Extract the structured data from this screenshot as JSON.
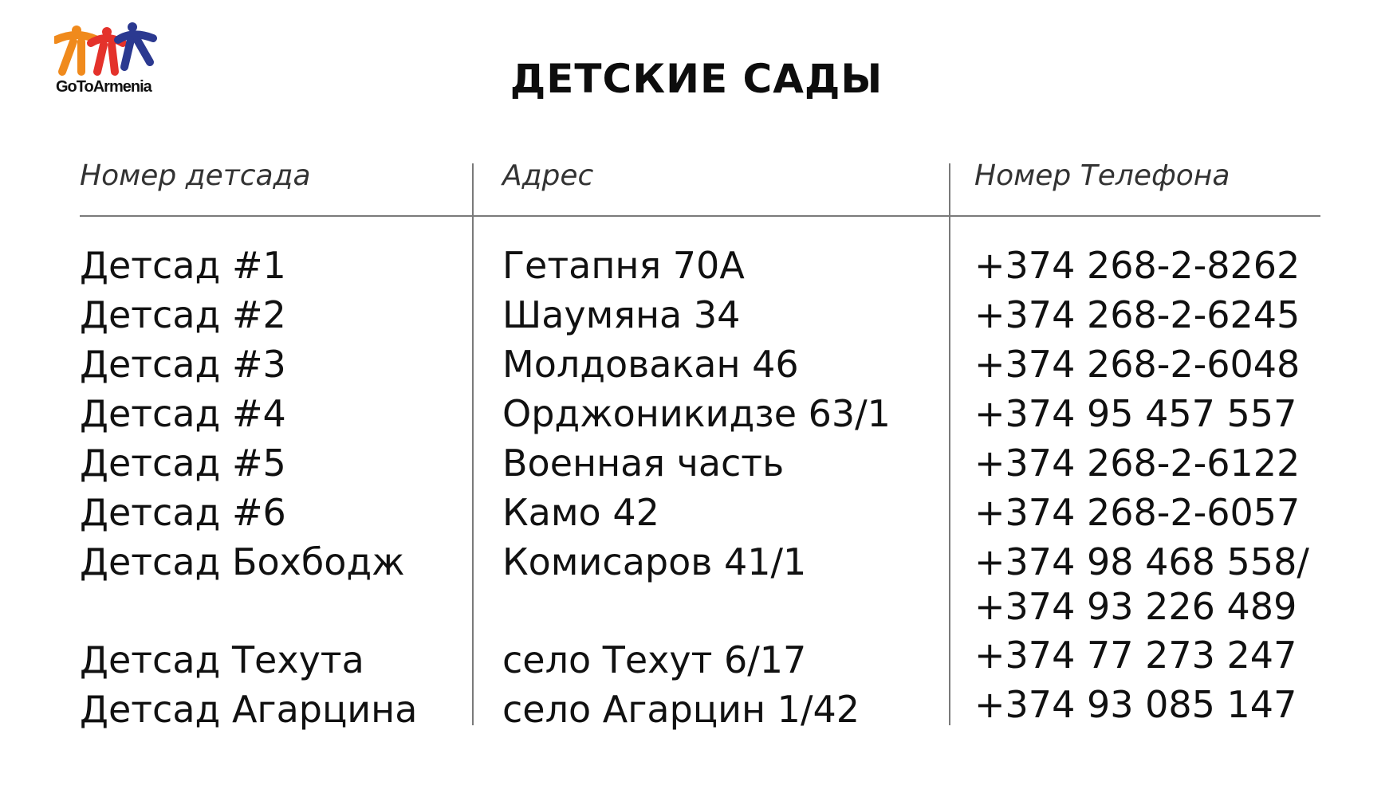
{
  "brand": {
    "name": "GoToArmenia",
    "colors": {
      "orange": "#F08A1C",
      "red": "#E4322B",
      "blue": "#2B3990"
    }
  },
  "title": "ДЕТСКИЕ САДЫ",
  "table": {
    "headers": {
      "name": "Номер детсада",
      "address": "Адрес",
      "phone": "Номер Телефона"
    },
    "rows": [
      {
        "name": "Детсад  #1",
        "address": "Гетапня 70А",
        "phone": "+374 268-2-8262"
      },
      {
        "name": "Детсад  #2",
        "address": "Шаумяна 34",
        "phone": "+374 268-2-6245"
      },
      {
        "name": "Детсад  #3",
        "address": "Молдовакан 46",
        "phone": "+374 268-2-6048"
      },
      {
        "name": "Детсад #4",
        "address": "Орджоникидзе 63/1",
        "phone": "+374 95 457 557"
      },
      {
        "name": "Детсад #5",
        "address": "Военная часть",
        "phone": "+374 268-2-6122"
      },
      {
        "name": "Детсад #6",
        "address": "Камо 42",
        "phone": "+374 268-2-6057"
      },
      {
        "name": "Детсад Бохбодж",
        "address": "Комисаров 41/1",
        "phone": "+374 98 468 558/",
        "phone2": "+374 93 226 489"
      },
      {
        "name": "Детсад Техута",
        "address": "село Техут 6/17",
        "phone": "+374 77 273 247"
      },
      {
        "name": "Детсад Агарцина",
        "address": "село Агарцин 1/42",
        "phone": "+374 93 085 147"
      }
    ]
  }
}
